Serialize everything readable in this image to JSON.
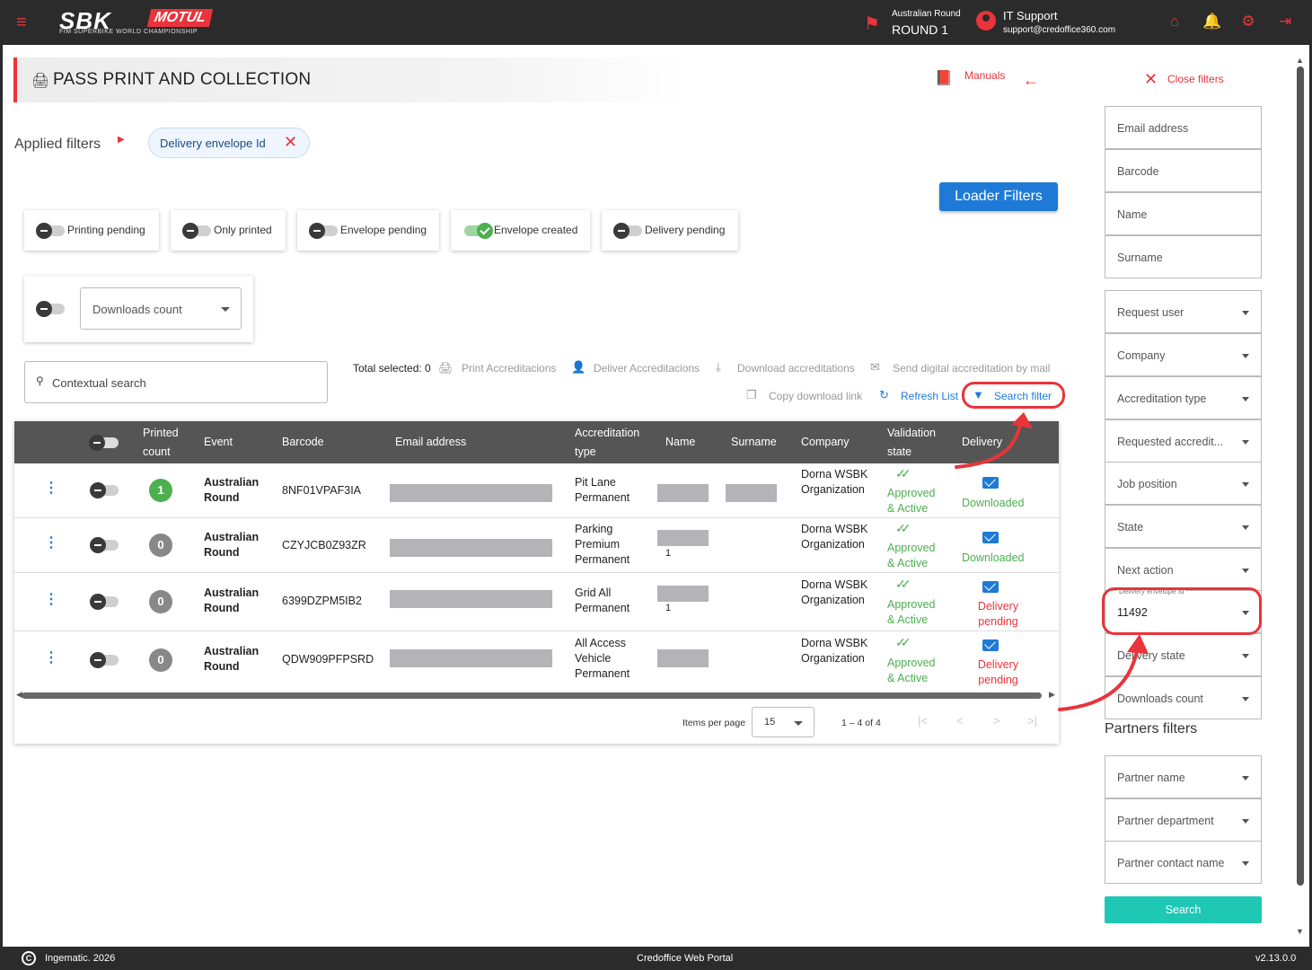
{
  "topbar": {
    "logo_main": "SBK",
    "logo_brand": "MOTUL",
    "logo_sub": "FIM SUPERBIKE WORLD CHAMPIONSHIP",
    "round_label": "Australian Round",
    "round_value": "ROUND 1",
    "user_name": "IT Support",
    "user_email": "support@credoffice360.com",
    "icons": [
      "menu-icon",
      "flag-icon",
      "user-icon",
      "home-icon",
      "bell-icon",
      "gear-icon",
      "logout-icon"
    ],
    "accent_color": "#e8343a"
  },
  "page": {
    "title": "PASS PRINT AND COLLECTION",
    "manuals_label": "Manuals"
  },
  "applied_filters": {
    "label": "Applied filters",
    "chip_label": "Delivery envelope Id"
  },
  "loader_filters_label": "Loader Filters",
  "toggles": [
    {
      "label": "Printing pending",
      "on": false
    },
    {
      "label": "Only printed",
      "on": false
    },
    {
      "label": "Envelope pending",
      "on": false
    },
    {
      "label": "Envelope created",
      "on": true
    },
    {
      "label": "Delivery pending",
      "on": false
    }
  ],
  "downloads_count_select": "Downloads count",
  "contextual_search_placeholder": "Contextual search",
  "actions": {
    "total_selected": "Total selected: 0",
    "print": "Print Accreditacions",
    "deliver": "Deliver Accreditacions",
    "download": "Download accreditations",
    "send_mail": "Send digital accreditation by mail",
    "copy_link": "Copy download link",
    "refresh": "Refresh List",
    "search_filter": "Search filter"
  },
  "table": {
    "headers": {
      "printed_count": "Printed count",
      "event": "Event",
      "barcode": "Barcode",
      "email": "Email address",
      "accreditation_type": "Accreditation type",
      "name": "Name",
      "surname": "Surname",
      "company": "Company",
      "validation_state": "Validation state",
      "delivery": "Delivery"
    },
    "rows": [
      {
        "count": "1",
        "event": "Australian Round",
        "barcode": "8NF01VPAF3IA",
        "acc_type": "Pit Lane Permanent",
        "name_extra": "",
        "company": "Dorna WSBK Organization",
        "validation": "Approved & Active",
        "delivery": "Downloaded",
        "delivery_pending": false
      },
      {
        "count": "0",
        "event": "Australian Round",
        "barcode": "CZYJCB0Z93ZR",
        "acc_type": "Parking Premium Permanent",
        "name_extra": "1",
        "company": "Dorna WSBK Organization",
        "validation": "Approved & Active",
        "delivery": "Downloaded",
        "delivery_pending": false
      },
      {
        "count": "0",
        "event": "Australian Round",
        "barcode": "6399DZPM5IB2",
        "acc_type": "Grid All Permanent",
        "name_extra": "1",
        "company": "Dorna WSBK Organization",
        "validation": "Approved & Active",
        "delivery": "Delivery pending",
        "delivery_pending": true
      },
      {
        "count": "0",
        "event": "Australian Round",
        "barcode": "QDW909PFPSRD",
        "acc_type": "All Access Vehicle Permanent",
        "name_extra": "",
        "company": "Dorna WSBK Organization",
        "validation": "Approved & Active",
        "delivery": "Delivery pending",
        "delivery_pending": true
      }
    ],
    "items_per_page_label": "Items per page",
    "items_per_page": "15",
    "range": "1 – 4 of 4"
  },
  "sidebar": {
    "close_label": "Close filters",
    "fields": [
      {
        "label": "Email address",
        "type": "text"
      },
      {
        "label": "Barcode",
        "type": "text"
      },
      {
        "label": "Name",
        "type": "text"
      },
      {
        "label": "Surname",
        "type": "text"
      },
      {
        "label": "Request user",
        "type": "select"
      },
      {
        "label": "Company",
        "type": "select"
      },
      {
        "label": "Accreditation type",
        "type": "select"
      },
      {
        "label": "Requested accredit...",
        "type": "select"
      },
      {
        "label": "Job position",
        "type": "select"
      },
      {
        "label": "State",
        "type": "select"
      },
      {
        "label": "Next action",
        "type": "select"
      },
      {
        "label": "Delivery envelope Id",
        "type": "select",
        "value": "11492"
      },
      {
        "label": "Delivery state",
        "type": "select"
      },
      {
        "label": "Downloads count",
        "type": "select"
      }
    ],
    "partners_title": "Partners filters",
    "partner_fields": [
      "Partner name",
      "Partner department",
      "Partner contact name"
    ],
    "search_label": "Search"
  },
  "footer": {
    "copyright": "Ingematic. 2026",
    "center": "Credoffice Web Portal",
    "version": "v2.13.0.0"
  }
}
